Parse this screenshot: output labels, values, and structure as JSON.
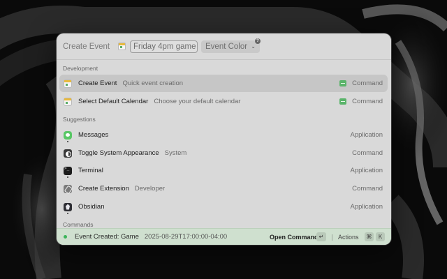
{
  "header": {
    "title": "Create Event",
    "event_input_value": "Friday 4pm game",
    "color_dropdown_label": "Event Color",
    "help_badge": "?"
  },
  "sections": {
    "development": "Development",
    "suggestions": "Suggestions",
    "commands": "Commands"
  },
  "development_items": [
    {
      "title": "Create Event",
      "subtitle": "Quick event creation",
      "accessory": "Command",
      "icon": "calendar-icon"
    },
    {
      "title": "Select Default Calendar",
      "subtitle": "Choose your default calendar",
      "accessory": "Command",
      "icon": "calendar-icon"
    }
  ],
  "suggestion_items": [
    {
      "title": "Messages",
      "subtitle": "",
      "accessory": "Application",
      "icon": "messages-icon"
    },
    {
      "title": "Toggle System Appearance",
      "subtitle": "System",
      "accessory": "Command",
      "icon": "appearance-icon"
    },
    {
      "title": "Terminal",
      "subtitle": "",
      "accessory": "Application",
      "icon": "terminal-icon"
    },
    {
      "title": "Create Extension",
      "subtitle": "Developer",
      "accessory": "Command",
      "icon": "extension-icon"
    },
    {
      "title": "Obsidian",
      "subtitle": "",
      "accessory": "Application",
      "icon": "obsidian-icon"
    }
  ],
  "footer": {
    "toast_title": "Event Created: Game",
    "toast_detail": "2025-08-29T17:00:00-04:00",
    "primary_action": "Open Command",
    "primary_key": "↵",
    "actions_label": "Actions",
    "actions_key_1": "⌘",
    "actions_key_2": "K"
  },
  "colors": {
    "accent_green": "#3cb45a",
    "window_bg": "#d9d9d9",
    "selected_row": "#c6c6c6"
  }
}
